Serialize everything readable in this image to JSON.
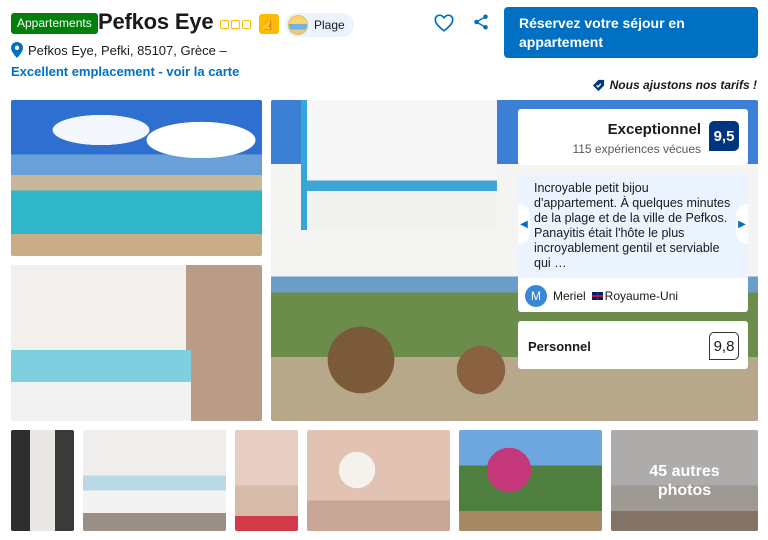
{
  "header": {
    "type_badge": "Appartements",
    "title": "Pefkos Eye",
    "star_count": 3,
    "beach_label": "Plage",
    "reserve_label": "Réservez votre séjour en appartement",
    "address": "Pefkos Eye, Pefki, 85107, Grèce –",
    "location_link": "Excellent emplacement - voir la carte",
    "price_match": "Nous ajustons nos tarifs !"
  },
  "score": {
    "word": "Exceptionnel",
    "count": "115 expériences vécues",
    "value": "9,5"
  },
  "review": {
    "text": "Incroyable petit bijou d'appartement. À quelques minutes de la plage et de la ville de Pefkos. Panayitis était l'hôte le plus incroyablement gentil et serviable qui …",
    "avatar_letter": "M",
    "name": "Meriel",
    "country": "Royaume-Uni"
  },
  "staff": {
    "label": "Personnel",
    "value": "9,8"
  },
  "gallery": {
    "more_count": "45 autres",
    "more_label": "photos"
  },
  "colors": {
    "brand_blue": "#0071c2",
    "dark_blue": "#003580",
    "green": "#008009",
    "star_yellow": "#febb02"
  }
}
